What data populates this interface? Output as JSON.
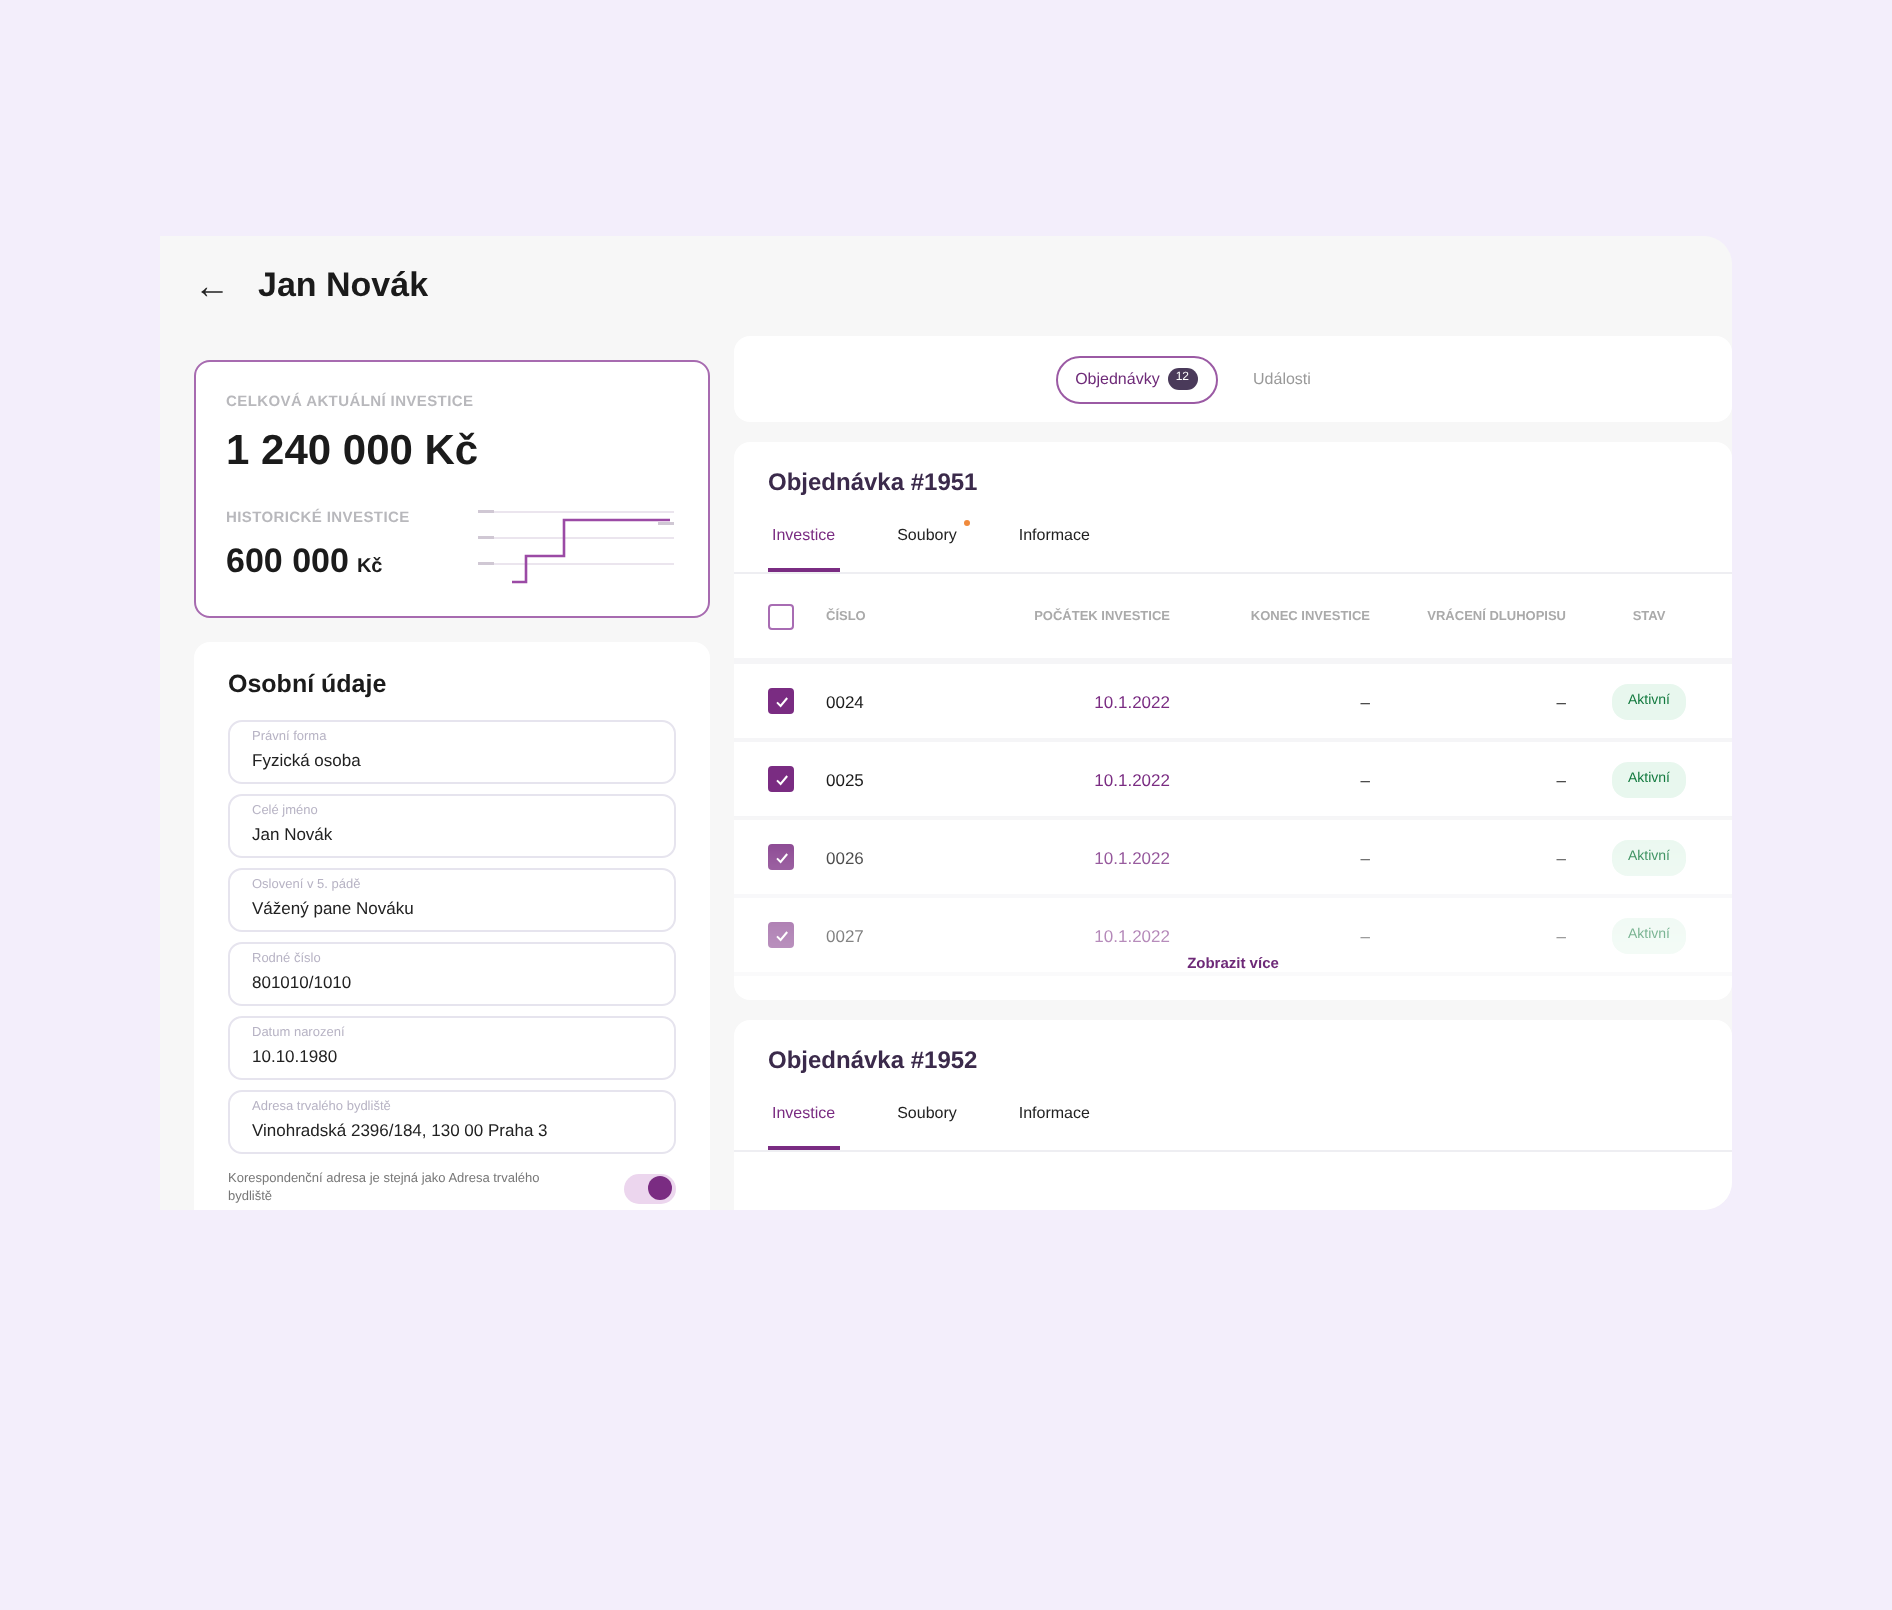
{
  "header": {
    "back": "←",
    "title": "Jan Novák"
  },
  "investment_card": {
    "total_label": "CELKOVÁ AKTUÁLNÍ INVESTICE",
    "total_value": "1 240 000 Kč",
    "historic_label": "HISTORICKÉ INVESTICE",
    "historic_value": "600 000",
    "historic_currency": "Kč"
  },
  "personal": {
    "title": "Osobní údaje",
    "fields": [
      {
        "label": "Právní forma",
        "value": "Fyzická osoba"
      },
      {
        "label": "Celé jméno",
        "value": "Jan Novák"
      },
      {
        "label": "Oslovení v 5. pádě",
        "value": "Vážený pane Nováku"
      },
      {
        "label": "Rodné číslo",
        "value": "801010/1010"
      },
      {
        "label": "Datum narození",
        "value": "10.10.1980"
      },
      {
        "label": "Adresa trvalého bydliště",
        "value": "Vinohradská 2396/184, 130 00 Praha 3"
      }
    ],
    "toggle": {
      "label": "Korespondenční adresa je stejná jako Adresa trvalého bydliště",
      "on": true
    }
  },
  "top_tabs": [
    {
      "label": "Objednávky",
      "badge": "12",
      "selected": true
    },
    {
      "label": "Události",
      "selected": false
    }
  ],
  "orders": [
    {
      "title": "Objednávka #1951",
      "tabs": [
        {
          "label": "Investice",
          "selected": true,
          "dot": false
        },
        {
          "label": "Soubory",
          "selected": false,
          "dot": true
        },
        {
          "label": "Informace",
          "selected": false,
          "dot": false
        }
      ],
      "table": {
        "header_checked": false,
        "columns": [
          "ČÍSLO",
          "POČÁTEK INVESTICE",
          "KONEC INVESTICE",
          "VRÁCENÍ DLUHOPISU",
          "STAV"
        ],
        "rows": [
          {
            "checked": true,
            "cells": [
              "0024",
              "10.1.2022",
              "–",
              "–"
            ],
            "status": "Aktivní"
          },
          {
            "checked": true,
            "cells": [
              "0025",
              "10.1.2022",
              "–",
              "–"
            ],
            "status": "Aktivní"
          },
          {
            "checked": true,
            "cells": [
              "0026",
              "10.1.2022",
              "–",
              "–"
            ],
            "status": "Aktivní"
          },
          {
            "checked": true,
            "cells": [
              "0027",
              "10.1.2022",
              "–",
              "–"
            ],
            "status": "Aktivní"
          }
        ]
      },
      "more": "Zobrazit více"
    },
    {
      "title": "Objednávka #1952",
      "tabs": [
        {
          "label": "Investice",
          "selected": true,
          "dot": false
        },
        {
          "label": "Soubory",
          "selected": false,
          "dot": false
        },
        {
          "label": "Informace",
          "selected": false,
          "dot": false
        }
      ]
    }
  ]
}
